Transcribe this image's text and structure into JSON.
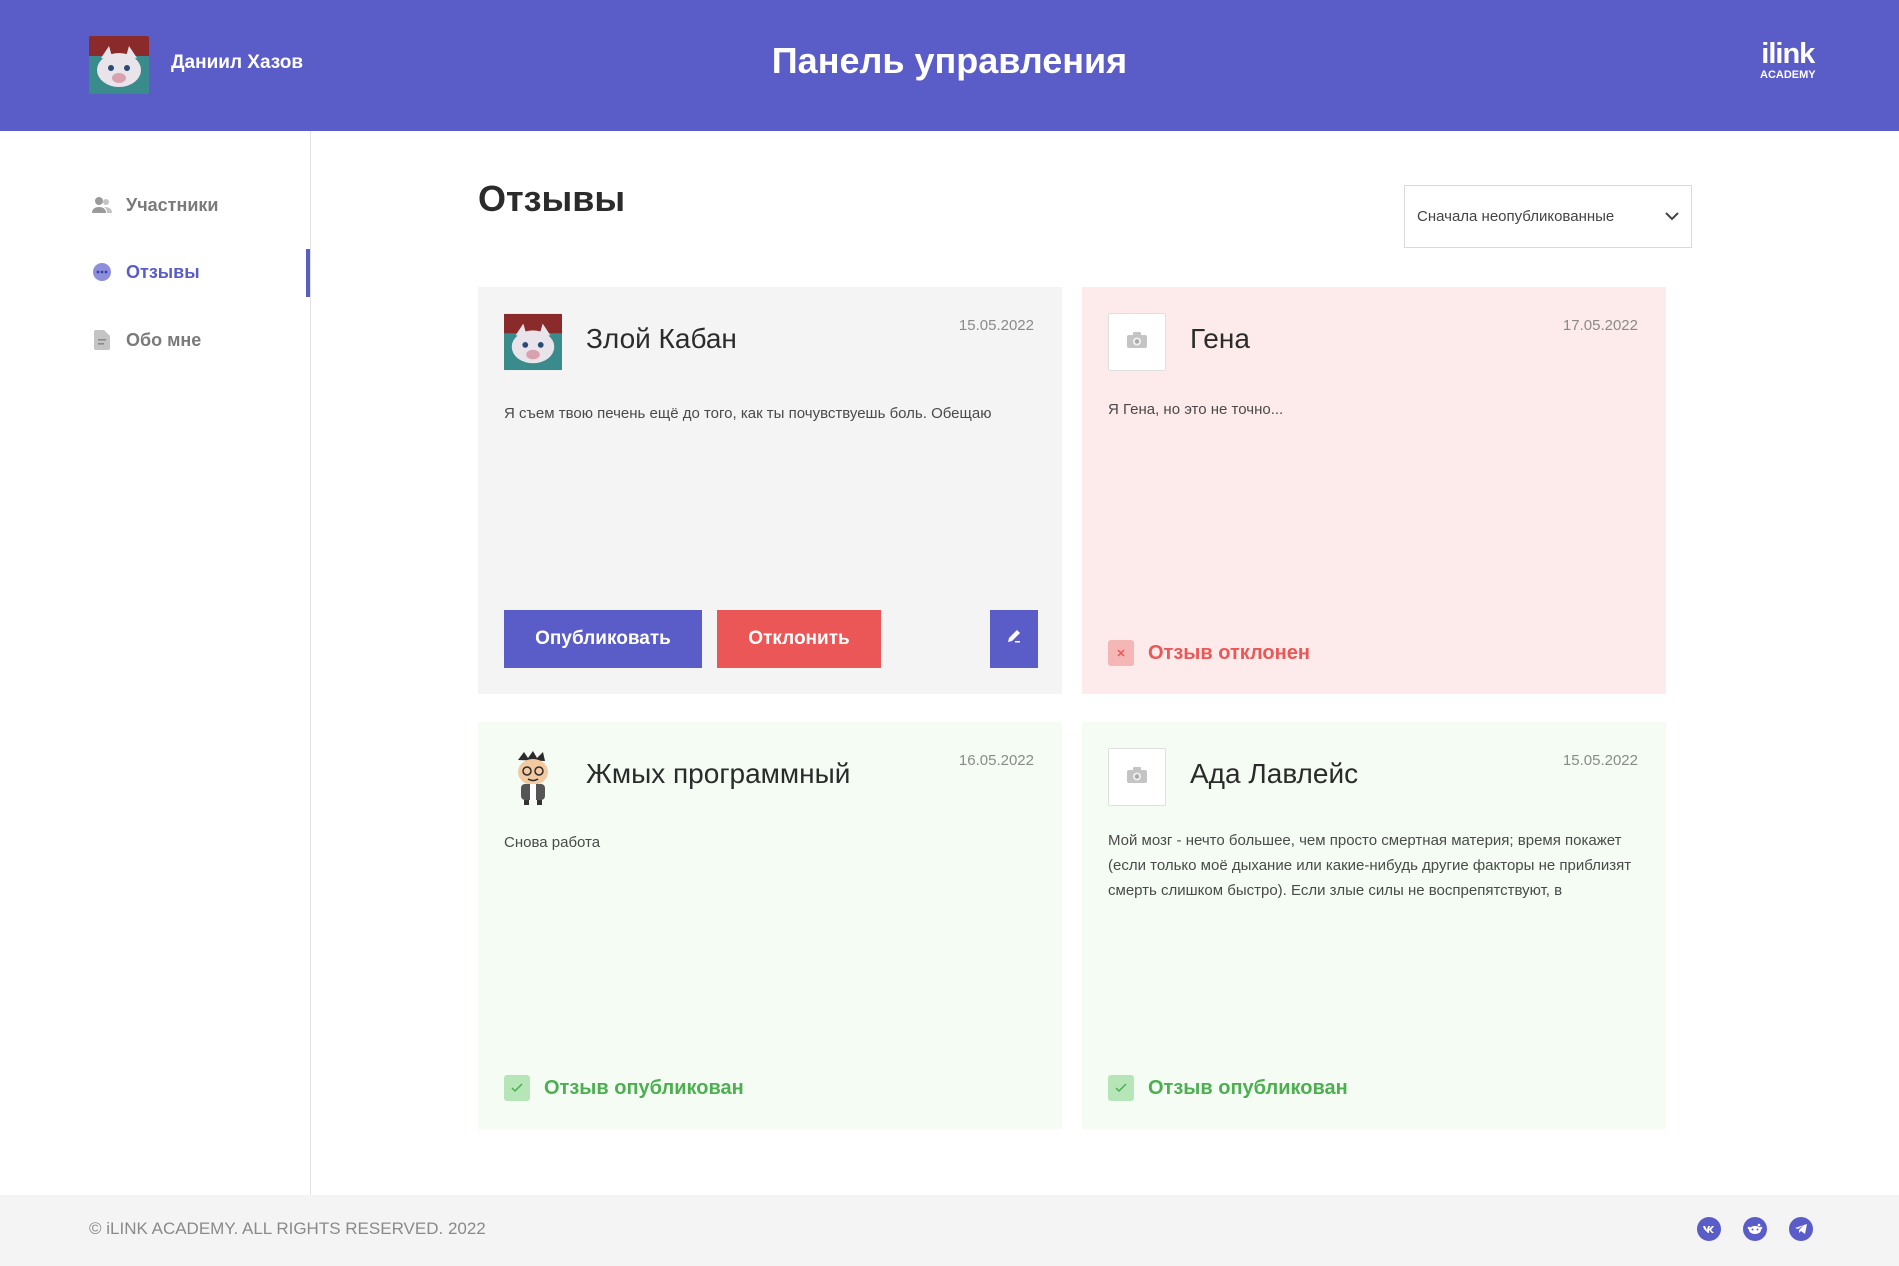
{
  "header": {
    "user_name": "Даниил Хазов",
    "title": "Панель управления",
    "logo_top": "ilink",
    "logo_bottom": "ACADEMY"
  },
  "sidebar": {
    "items": [
      {
        "label": "Участники",
        "icon": "users-icon"
      },
      {
        "label": "Отзывы",
        "icon": "chat-bubble-icon",
        "active": true
      },
      {
        "label": "Обо мне",
        "icon": "document-icon"
      }
    ]
  },
  "main": {
    "title": "Отзывы",
    "sort": {
      "selected": "Сначала неопубликованные"
    },
    "reviews": [
      {
        "name": "Злой Кабан",
        "date": "15.05.2022",
        "text": "Я съем твою печень ещё до того, как ты почувствуешь боль. Обещаю",
        "publish_label": "Опубликовать",
        "reject_label": "Отклонить"
      },
      {
        "name": "Гена",
        "date": "17.05.2022",
        "text": "Я Гена, но это не точно...",
        "status": "Отзыв отклонен"
      },
      {
        "name": "Жмых программный",
        "date": "16.05.2022",
        "text": "Снова работа",
        "status": "Отзыв опубликован"
      },
      {
        "name": "Ада Лавлейс",
        "date": "15.05.2022",
        "text": "Мой мозг - нечто большее, чем просто смертная материя; время покажет (если только моё дыхание или какие-нибудь другие факторы не приблизят смерть слишком быстро). Если злые силы не воспрепятствуют, в",
        "status": "Отзыв опубликован"
      }
    ]
  },
  "footer": {
    "copyright": "© iLINK ACADEMY. ALL RIGHTS RESERVED. 2022",
    "social": [
      "vk-icon",
      "reddit-icon",
      "telegram-icon"
    ]
  },
  "colors": {
    "brand": "#5a5cc8",
    "danger": "#eb5757",
    "success": "#4caf50"
  }
}
